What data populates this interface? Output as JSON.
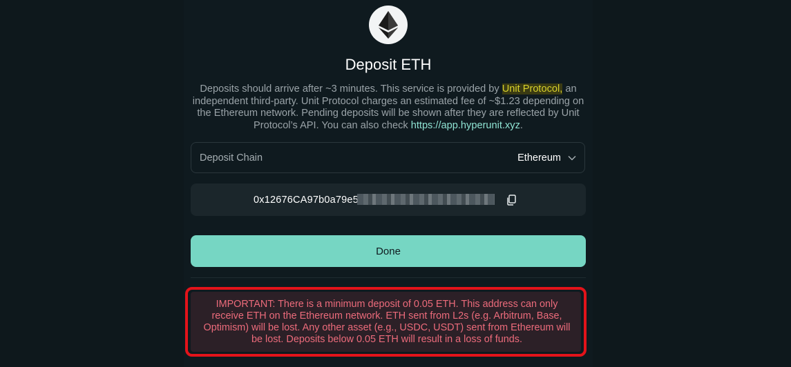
{
  "dialog": {
    "icon": "ethereum-logo-icon",
    "title": "Deposit ETH",
    "description": {
      "part1": "Deposits should arrive after ~3 minutes. This service is provided by ",
      "provider_highlight": "Unit Protocol,",
      "part2": " an independent third-party. Unit Protocol charges an estimated fee of ~$1.23 depending on the Ethereum network. Pending deposits will be shown after they are reflected by Unit Protocol’s API. You can also check ",
      "link_text": "https://app.hyperunit.xyz",
      "part3": "."
    }
  },
  "deposit_chain": {
    "label": "Deposit Chain",
    "selected": "Ethereum",
    "dropdown_icon": "chevron-down-icon"
  },
  "address": {
    "visible_prefix": "0x12676CA97b0a79e5",
    "copy_icon": "copy-icon"
  },
  "done_button": {
    "label": "Done"
  },
  "warning": {
    "text": "IMPORTANT: There is a minimum deposit of 0.05 ETH. This address can only receive ETH on the Ethereum network. ETH sent from L2s (e.g. Arbitrum, Base, Optimism) will be lost. Any other asset (e.g., USDC, USDT) sent from Ethereum will be lost. Deposits below 0.05 ETH will result in a loss of funds."
  },
  "colors": {
    "background": "#0f1a1f",
    "accent": "#76d6c3",
    "link": "#8fe3d3",
    "highlight_text": "#d8d22b",
    "warning_text": "#ec6b7b",
    "warning_outline": "#e3131a"
  }
}
